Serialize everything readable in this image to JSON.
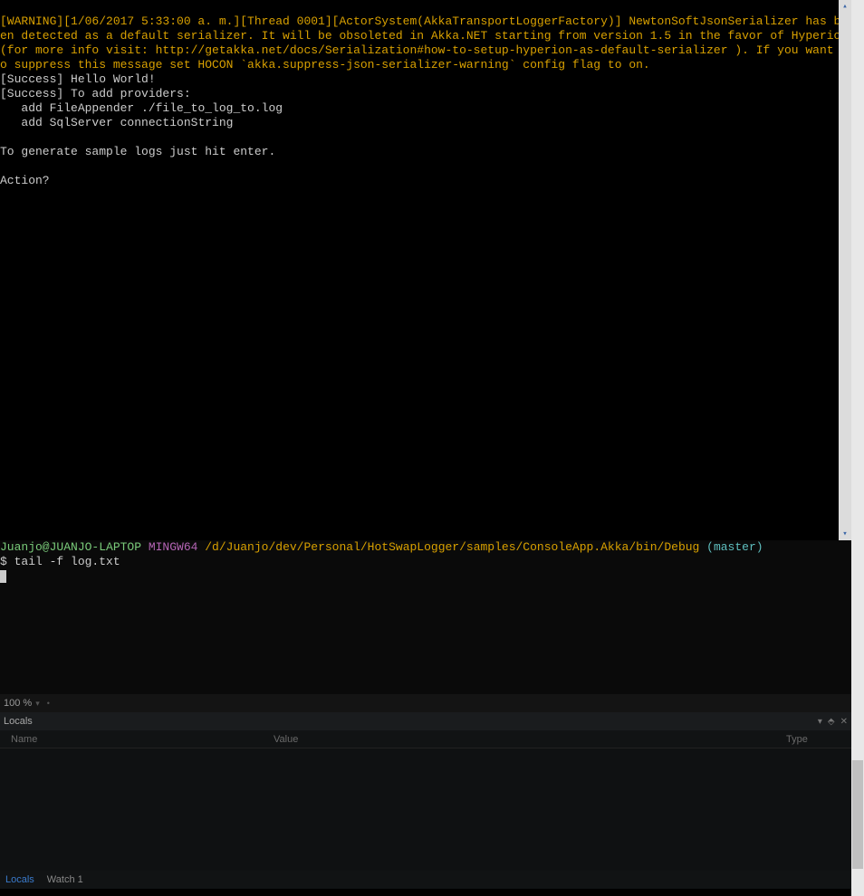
{
  "console": {
    "warning_line": "[WARNING][1/06/2017 5:33:00 a. m.][Thread 0001][ActorSystem(AkkaTransportLoggerFactory)] NewtonSoftJsonSerializer has been detected as a default serializer. It will be obsoleted in Akka.NET starting from version 1.5 in the favor of Hyperion (for more info visit: http://getakka.net/docs/Serialization#how-to-setup-hyperion-as-default-serializer ). If you want to suppress this message set HOCON `akka.suppress-json-serializer-warning` config flag to on.",
    "lines": [
      "[Success] Hello World!",
      "[Success] To add providers:",
      "   add FileAppender ./file_to_log_to.log",
      "   add SqlServer connectionString",
      "",
      "To generate sample logs just hit enter.",
      "",
      "Action?"
    ]
  },
  "terminal2": {
    "user_host": "Juanjo@JUANJO-LAPTOP",
    "mingw": " MINGW64",
    "path": " /d/Juanjo/dev/Personal/HotSwapLogger/samples/ConsoleApp.Akka/bin/Debug",
    "branch": " (master)",
    "prompt": "$ ",
    "command": "tail -f log.txt"
  },
  "zoom": {
    "level": "100 %"
  },
  "locals": {
    "title": "Locals",
    "columns": {
      "name": "Name",
      "value": "Value",
      "type": "Type"
    }
  },
  "tabs": {
    "locals": "Locals",
    "watch": "Watch 1"
  }
}
